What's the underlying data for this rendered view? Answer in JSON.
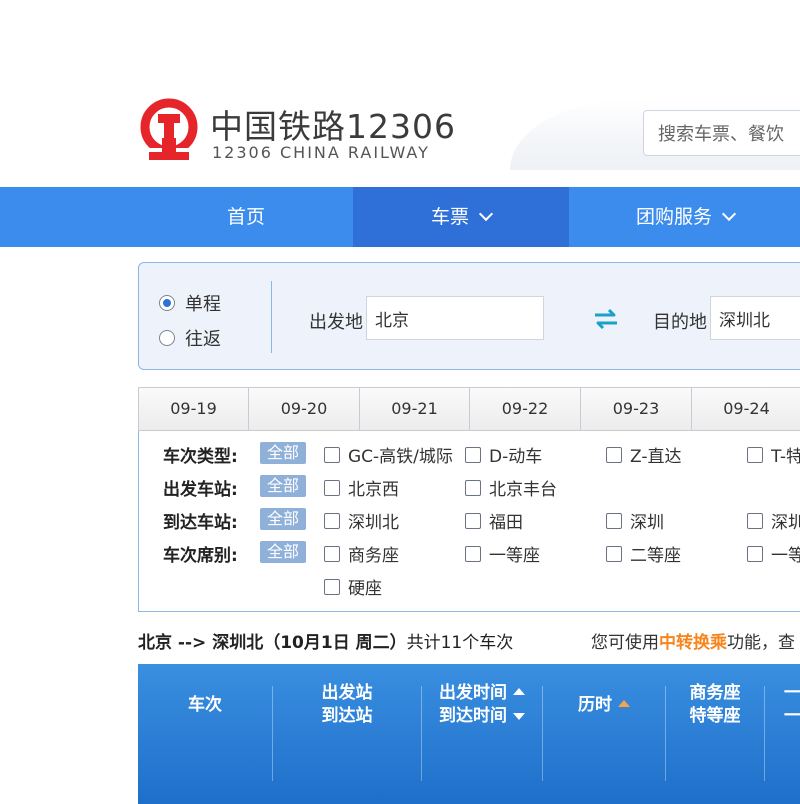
{
  "header": {
    "brand_title": "中国铁路12306",
    "brand_subtitle": "12306 CHINA RAILWAY",
    "search_placeholder": "搜索车票、餐饮",
    "logo_icon": "railway-logo-icon",
    "logo_color": "#e5252a"
  },
  "nav": {
    "items": [
      {
        "label": "首页"
      },
      {
        "label": "车票",
        "active": true
      },
      {
        "label": "团购服务"
      }
    ],
    "color": "#3c8cee",
    "active_color": "#2f70d8"
  },
  "search": {
    "trip_types": [
      {
        "label": "单程",
        "selected": true
      },
      {
        "label": "往返",
        "selected": false
      }
    ],
    "from_label": "出发地",
    "from_value": "北京",
    "to_label": "目的地",
    "to_value": "深圳北",
    "swap_icon": "swap-arrows-icon"
  },
  "dates": [
    "09-19",
    "09-20",
    "09-21",
    "09-22",
    "09-23",
    "09-24"
  ],
  "filters": {
    "all_label": "全部",
    "rows": [
      {
        "label": "车次类型:",
        "options": [
          "GC-高铁/城际",
          "D-动车",
          "Z-直达",
          "T-特"
        ]
      },
      {
        "label": "出发车站:",
        "options": [
          "北京西",
          "北京丰台"
        ]
      },
      {
        "label": "到达车站:",
        "options": [
          "深圳北",
          "福田",
          "深圳",
          "深圳"
        ]
      },
      {
        "label": "车次席别:",
        "options": [
          "商务座",
          "一等座",
          "二等座",
          "一等",
          "硬座"
        ]
      }
    ]
  },
  "summary": {
    "route": "北京 --> 深圳北",
    "date_text": "（10月1日  周二）",
    "count_text": "共计11个车次",
    "hint_prefix": "您可使用",
    "hint_highlight": "中转换乘",
    "hint_suffix": "功能，查"
  },
  "table_header": {
    "col_train": "车次",
    "col_station_top": "出发站",
    "col_station_bottom": "到达站",
    "col_time_top": "出发时间",
    "col_time_bottom": "到达时间",
    "col_duration": "历时",
    "col_seat_top": "商务座",
    "col_seat_bottom": "特等座",
    "col_next_top": "一",
    "col_next_bottom": "一"
  }
}
